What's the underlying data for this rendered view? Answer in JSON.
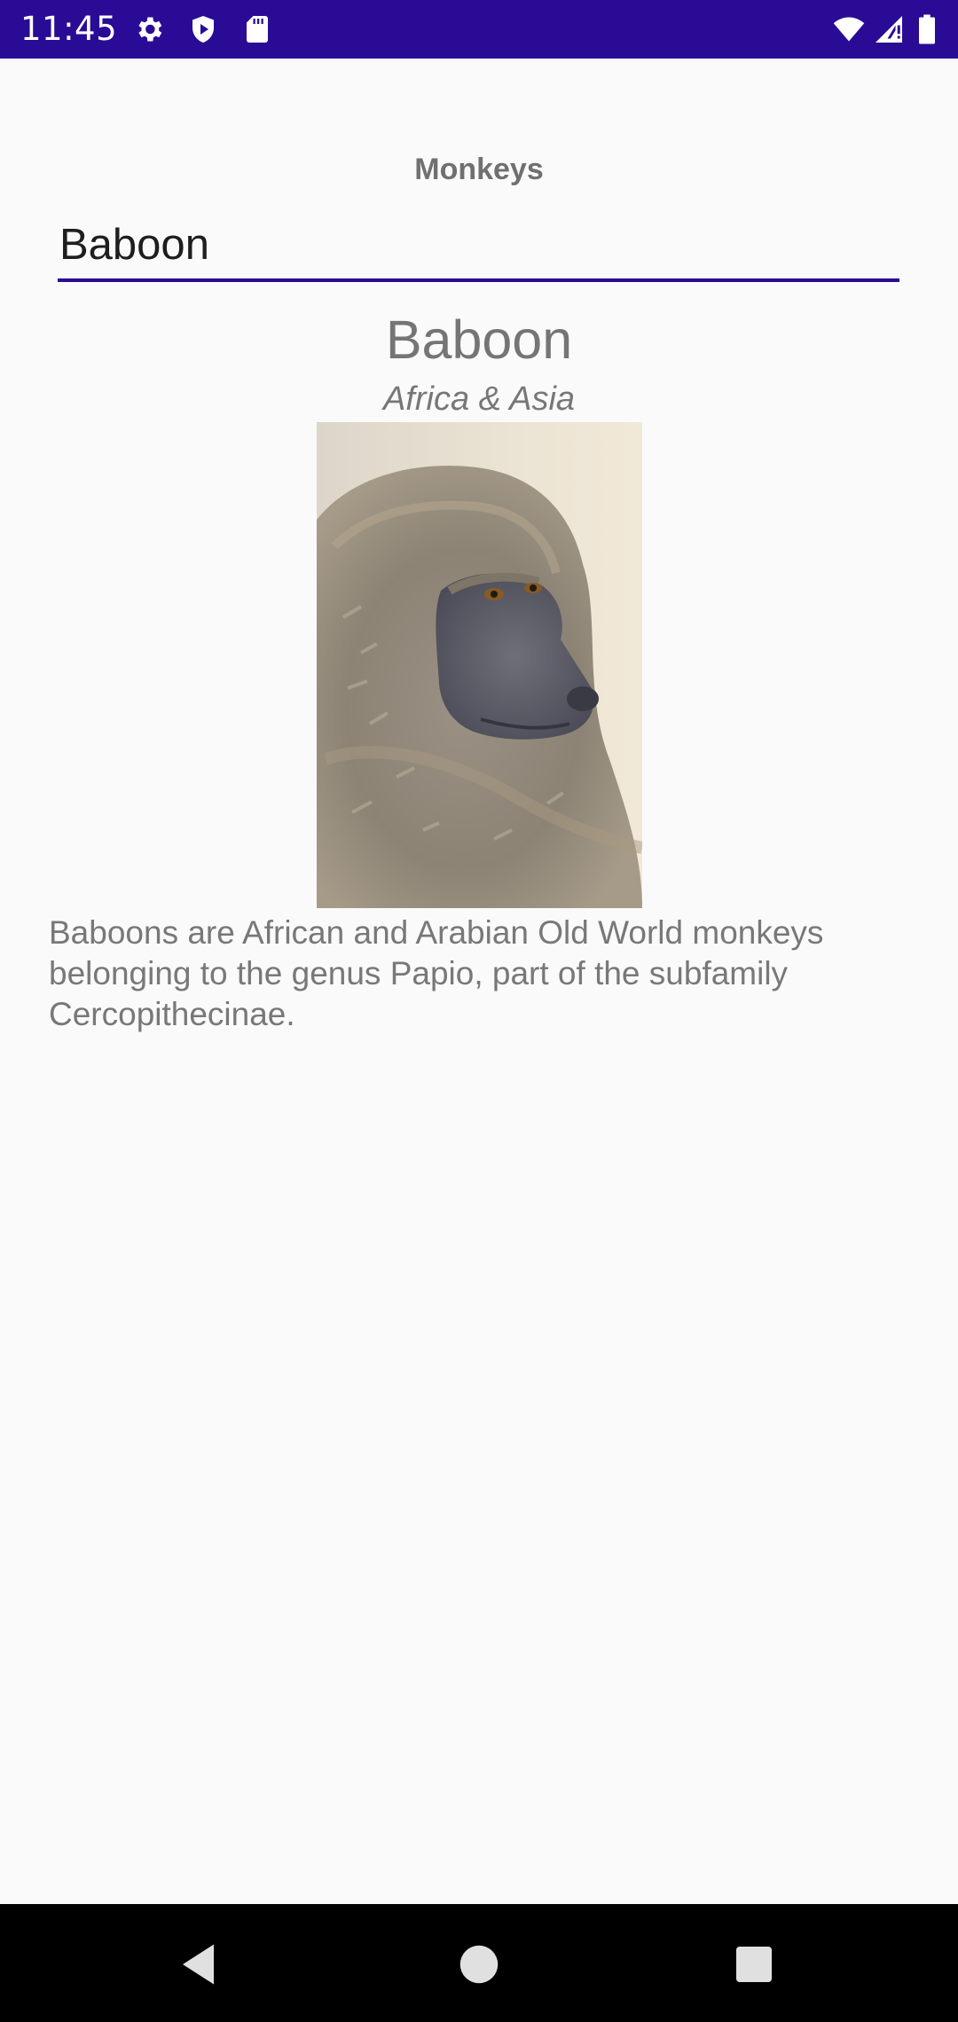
{
  "status_bar": {
    "time": "11:45",
    "icons_left": [
      "gear-icon",
      "shield-icon",
      "sd-card-icon"
    ],
    "icons_right": [
      "wifi-icon",
      "cell-signal-icon",
      "battery-icon"
    ],
    "background_color": "#2a0b96"
  },
  "page": {
    "title": "Monkeys"
  },
  "search": {
    "value": "Baboon",
    "underline_color": "#2a0b96"
  },
  "monkey": {
    "name": "Baboon",
    "location": "Africa & Asia",
    "details": "Baboons are African and Arabian Old World monkeys belonging to the genus Papio, part of the subfamily Cercopithecinae.",
    "image_alt": "Baboon"
  },
  "nav_bar": {
    "buttons": [
      "back-icon",
      "home-icon",
      "recents-icon"
    ]
  }
}
